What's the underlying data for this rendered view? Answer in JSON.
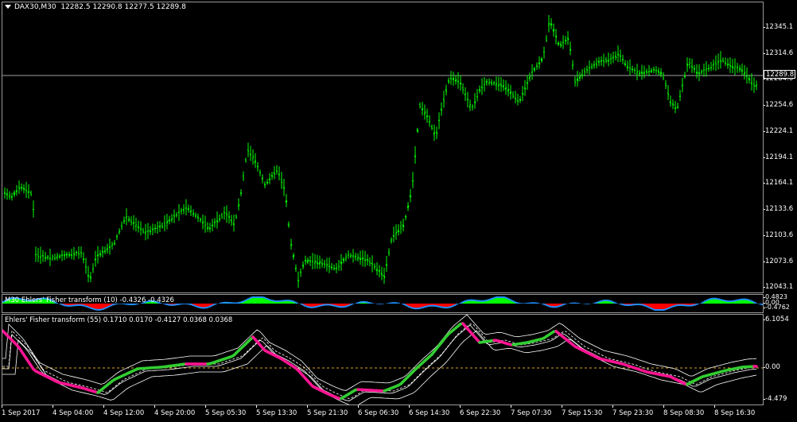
{
  "main": {
    "symbol_period": "DAX30,M30",
    "ohlc": "12282.5 12290.8 12277.5 12289.8",
    "price_levels": [
      "12345.1",
      "12314.6",
      "12284.6",
      "12254.6",
      "12224.1",
      "12194.1",
      "12164.1",
      "12133.6",
      "12103.6",
      "12073.6",
      "12043.1"
    ],
    "current_price": "12289.8",
    "colors": {
      "bars": "#00ff00",
      "price_line": "#a0a0a0",
      "background": "#000000"
    }
  },
  "fisher10": {
    "title": "M30 Ehlers' Fisher transform (10) -0.4326 -0.4326",
    "levels": [
      "0.4823",
      "0.00",
      "-0.4762"
    ],
    "colors": {
      "positive": "#00ff00",
      "negative": "#ff0000",
      "line": "#1e90ff"
    }
  },
  "fisher55": {
    "title": "Ehlers' Fisher transform (55) 0.1710 0.0170 -0.4127 0.0368 0.0368",
    "levels": [
      "6.1054",
      "0.00",
      "-4.479"
    ],
    "colors": {
      "up": "#32cd32",
      "down": "#ff1493",
      "bands": "#ffffff",
      "zero": "#daa520"
    }
  },
  "time_axis": [
    "1 Sep 2017",
    "4 Sep 04:00",
    "4 Sep 12:00",
    "4 Sep 20:00",
    "5 Sep 05:30",
    "5 Sep 13:30",
    "5 Sep 21:30",
    "6 Sep 06:30",
    "6 Sep 14:30",
    "6 Sep 22:30",
    "7 Sep 07:30",
    "7 Sep 15:30",
    "7 Sep 23:30",
    "8 Sep 08:30",
    "8 Sep 16:30"
  ]
}
